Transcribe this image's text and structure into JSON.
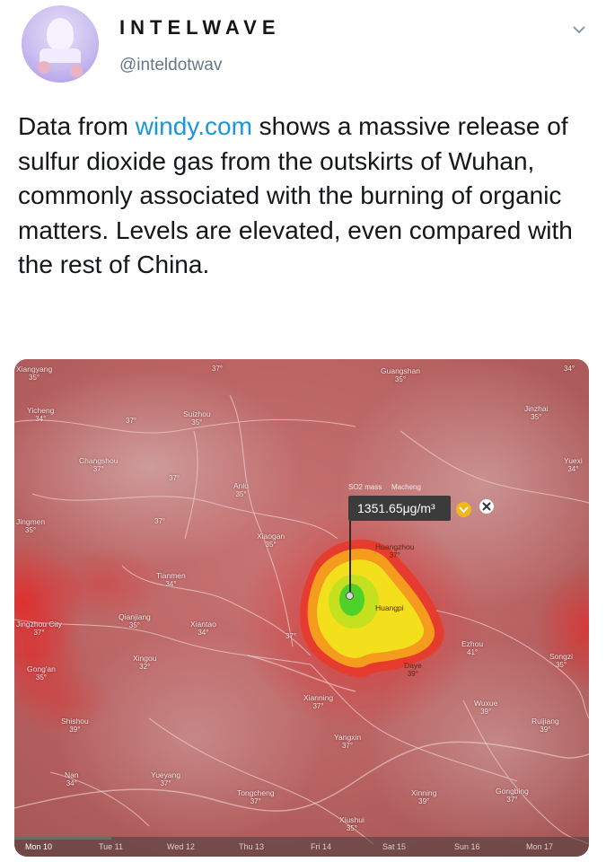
{
  "tweet": {
    "display_name": "INTELWAVE",
    "handle": "@inteldotwav",
    "text_before_link": "Data from ",
    "link_text": "windy.com",
    "text_after_link": " shows a massive release of sulfur dioxide gas from the outskirts of Wuhan, commonly associated with the burning of organic matters. Levels are elevated, even compared with the rest of China."
  },
  "map": {
    "popup": {
      "layer_label": "SO2 mass",
      "location": "Macheng",
      "value": "1351.65μg/m³"
    },
    "places": [
      {
        "name": "Xiangyang",
        "temp": "35°"
      },
      {
        "name": "",
        "temp": "37°"
      },
      {
        "name": "Guangshan",
        "temp": "35°"
      },
      {
        "name": "",
        "temp": "34°"
      },
      {
        "name": "Yicheng",
        "temp": "34°"
      },
      {
        "name": "Suizhou",
        "temp": "35°"
      },
      {
        "name": "Jinzhai",
        "temp": "35°"
      },
      {
        "name": "",
        "temp": "37°"
      },
      {
        "name": "Changshou",
        "temp": "37°"
      },
      {
        "name": "Yuexi",
        "temp": "34°"
      },
      {
        "name": "",
        "temp": "37°"
      },
      {
        "name": "Anlu",
        "temp": "35°"
      },
      {
        "name": "Jingmen",
        "temp": "35°"
      },
      {
        "name": "",
        "temp": "37°"
      },
      {
        "name": "Xiaogan",
        "temp": "35°"
      },
      {
        "name": "Huangzhou",
        "temp": "37°"
      },
      {
        "name": "Tianmen",
        "temp": "34°"
      },
      {
        "name": "Huangpi",
        "temp": ""
      },
      {
        "name": "Qianjiang",
        "temp": "35°"
      },
      {
        "name": "Xiantao",
        "temp": "34°"
      },
      {
        "name": "Jingzhou City",
        "temp": "37°"
      },
      {
        "name": "",
        "temp": "37°"
      },
      {
        "name": "Ezhou",
        "temp": "41°"
      },
      {
        "name": "Xingou",
        "temp": "32°"
      },
      {
        "name": "Gong'an",
        "temp": "35°"
      },
      {
        "name": "Daye",
        "temp": "39°"
      },
      {
        "name": "Songzi",
        "temp": "35°"
      },
      {
        "name": "Xianning",
        "temp": "37°"
      },
      {
        "name": "Wuxue",
        "temp": "39°"
      },
      {
        "name": "Shishou",
        "temp": "39°"
      },
      {
        "name": "Ruijiang",
        "temp": "39°"
      },
      {
        "name": "Yangxin",
        "temp": "37°"
      },
      {
        "name": "Nan",
        "temp": "34°"
      },
      {
        "name": "Yueyang",
        "temp": "37°"
      },
      {
        "name": "Tongcheng",
        "temp": "37°"
      },
      {
        "name": "Xiushui",
        "temp": "35°"
      },
      {
        "name": "Xinning",
        "temp": "39°"
      },
      {
        "name": "Gongbing",
        "temp": "37°"
      }
    ],
    "days": [
      "Mon 10",
      "Tue 11",
      "Wed 12",
      "Thu 13",
      "Fri 14",
      "Sat 15",
      "Sun 16",
      "Mon 17"
    ],
    "colors": {
      "base": "#b86565",
      "hotspot_edge": "#e23a2a",
      "hotspot_mid": "#f1d21c",
      "hotspot_core": "#3fcf2b"
    }
  }
}
